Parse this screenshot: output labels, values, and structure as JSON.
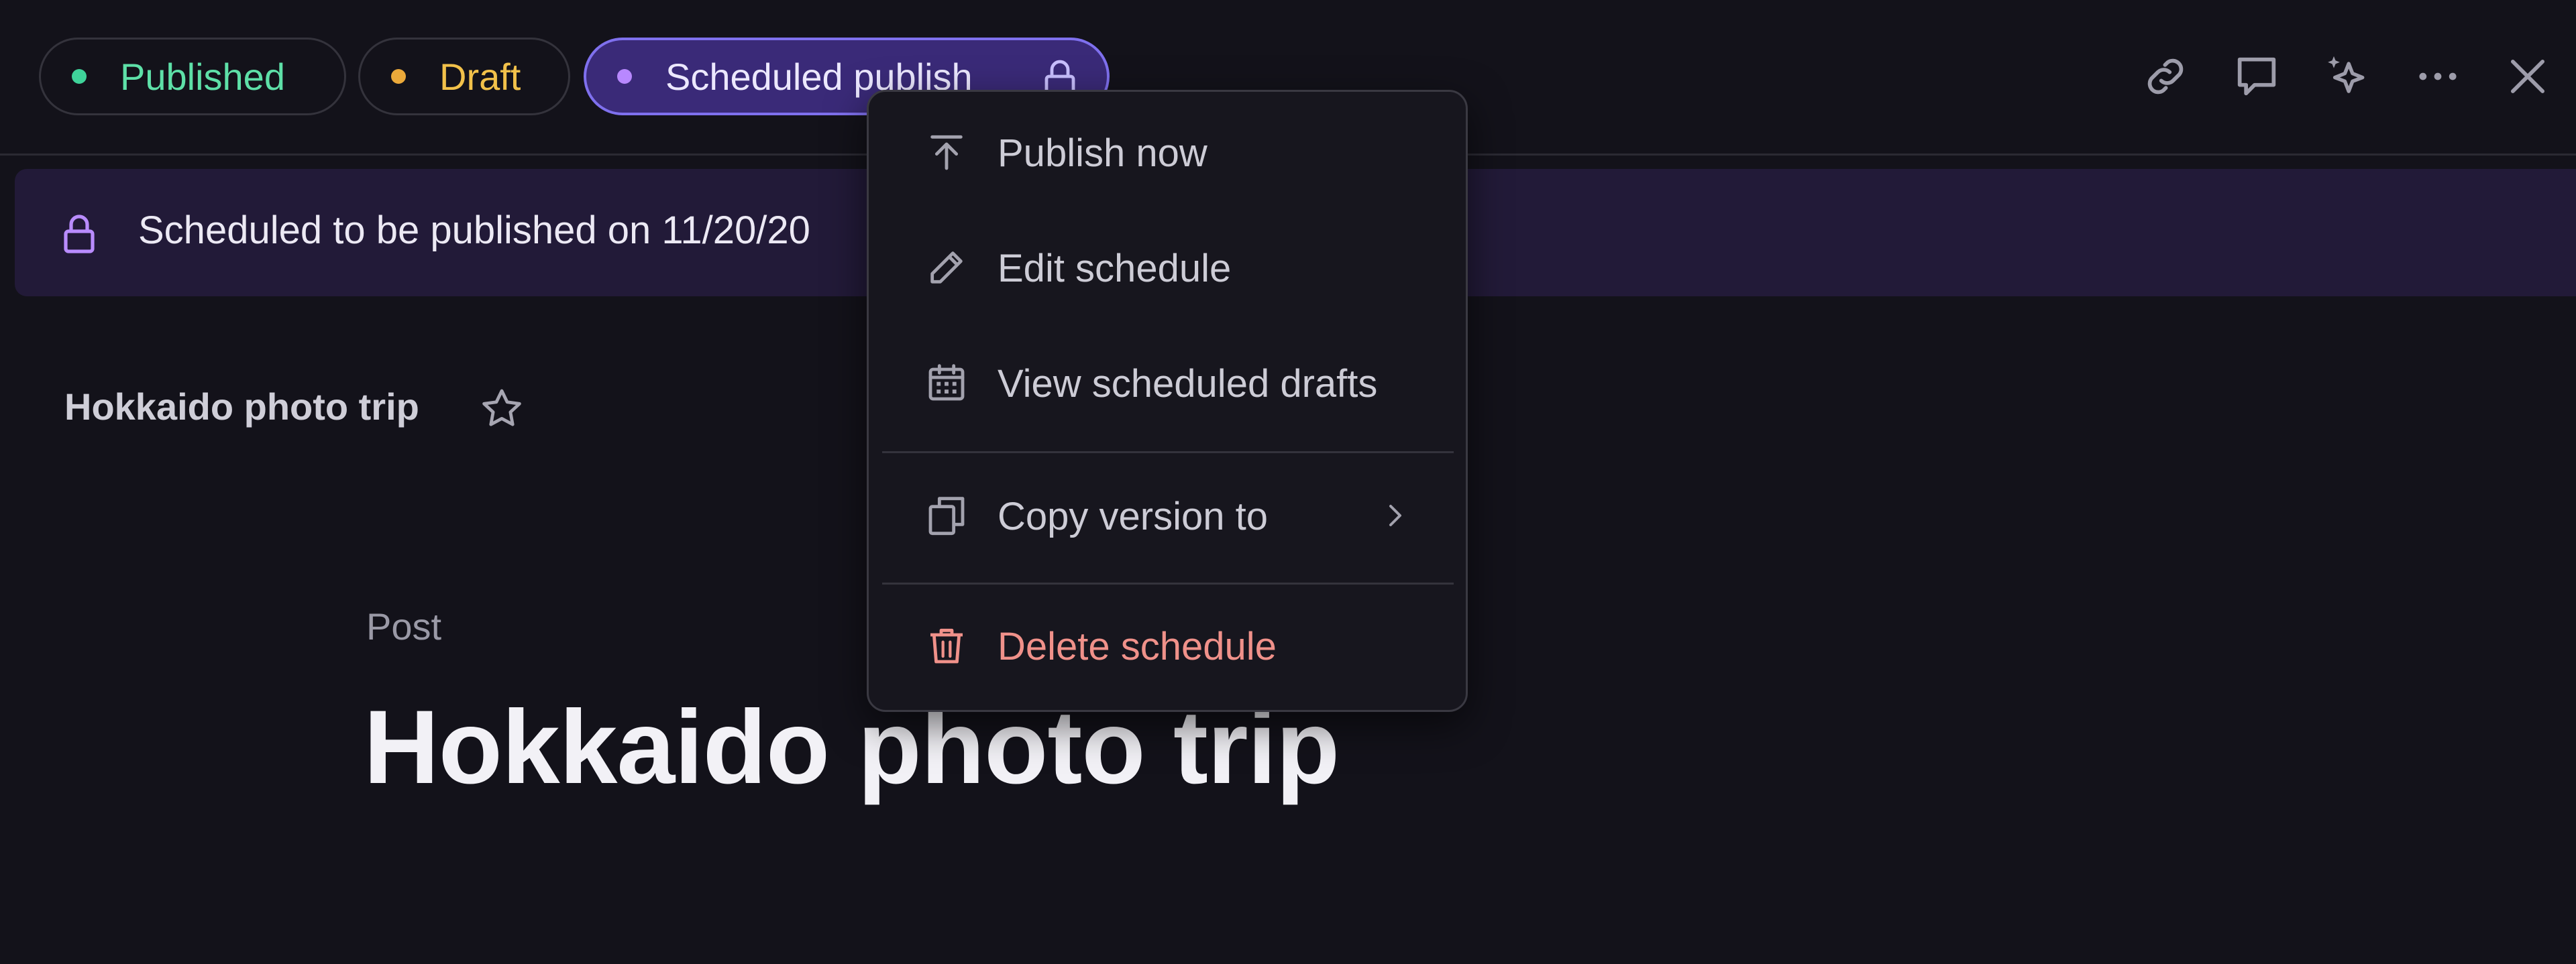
{
  "status_pills": {
    "published": {
      "label": "Published",
      "dot_color": "#3fd39a"
    },
    "draft": {
      "label": "Draft",
      "dot_color": "#eba93a"
    },
    "scheduled": {
      "label": "Scheduled publish",
      "dot_color": "#b888ff",
      "icon": "lock-icon"
    }
  },
  "toolbar_icons": [
    "link-icon",
    "comment-icon",
    "sparkle-icon",
    "more-icon",
    "close-icon"
  ],
  "banner": {
    "icon": "lock-icon",
    "text": "Scheduled to be published on 11/20/20"
  },
  "document": {
    "header_title": "Hokkaido photo trip",
    "type_label": "Post",
    "title": "Hokkaido photo trip"
  },
  "context_menu": {
    "items": [
      {
        "label": "Publish now",
        "icon": "publish-icon"
      },
      {
        "label": "Edit schedule",
        "icon": "pencil-icon"
      },
      {
        "label": "View scheduled drafts",
        "icon": "calendar-icon"
      },
      {
        "label": "Copy version to",
        "icon": "copy-icon",
        "submenu": true
      },
      {
        "label": "Delete schedule",
        "icon": "trash-icon",
        "destructive": true,
        "color": "#f0918a"
      }
    ]
  },
  "colors": {
    "background": "#13121a",
    "accent": "#7f70ee",
    "banner_bg": "#221a38"
  }
}
